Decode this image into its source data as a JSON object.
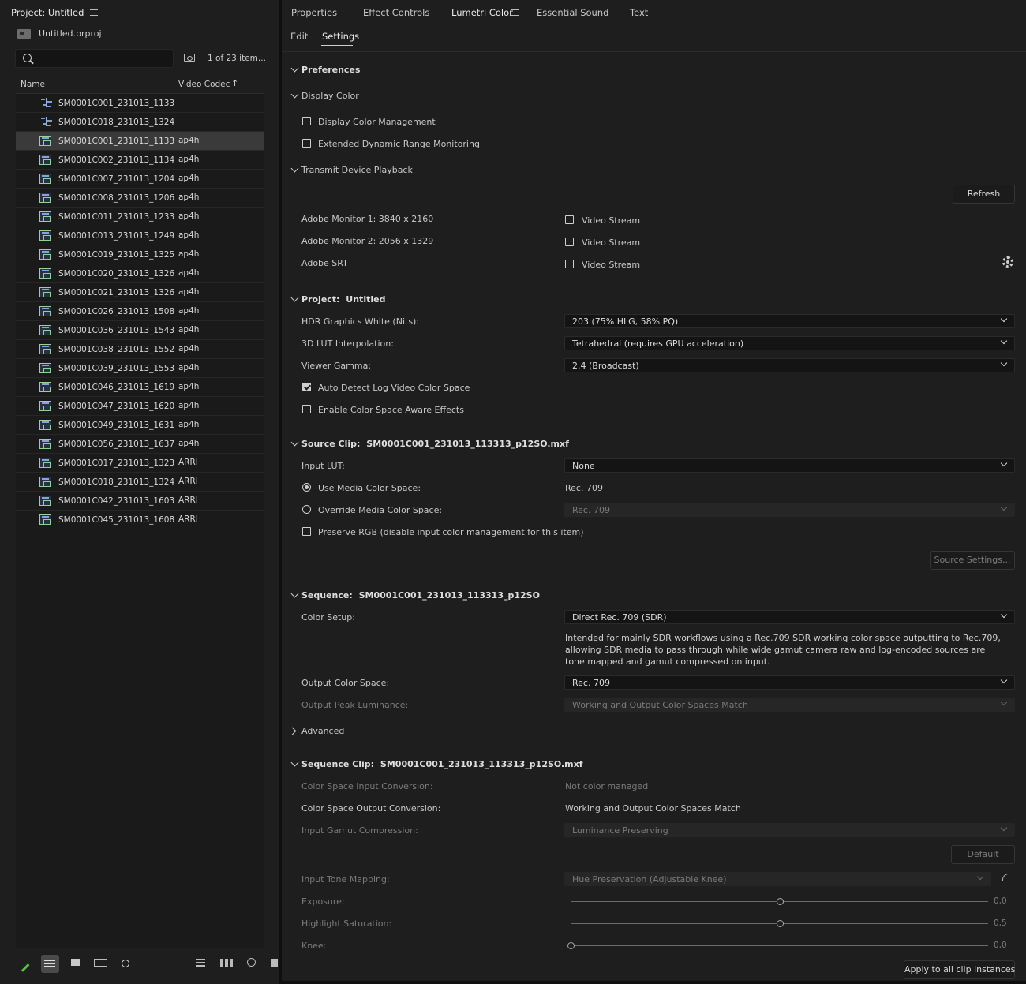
{
  "project_panel": {
    "title": "Project: Untitled",
    "file": "Untitled.prproj",
    "search_value": "",
    "item_count": "1 of 23 item...",
    "columns": {
      "name": "Name",
      "codec": "Video Codec"
    },
    "items": [
      {
        "name": "SM0001C001_231013_1133",
        "codec": "",
        "type": "sequence"
      },
      {
        "name": "SM0001C018_231013_1324",
        "codec": "",
        "type": "sequence"
      },
      {
        "name": "SM0001C001_231013_1133",
        "codec": "ap4h",
        "type": "clip",
        "selected": true
      },
      {
        "name": "SM0001C002_231013_1134",
        "codec": "ap4h",
        "type": "clip"
      },
      {
        "name": "SM0001C007_231013_1204",
        "codec": "ap4h",
        "type": "clip"
      },
      {
        "name": "SM0001C008_231013_1206",
        "codec": "ap4h",
        "type": "clip"
      },
      {
        "name": "SM0001C011_231013_1233",
        "codec": "ap4h",
        "type": "clip"
      },
      {
        "name": "SM0001C013_231013_1249",
        "codec": "ap4h",
        "type": "clip"
      },
      {
        "name": "SM0001C019_231013_1325",
        "codec": "ap4h",
        "type": "clip"
      },
      {
        "name": "SM0001C020_231013_1326",
        "codec": "ap4h",
        "type": "clip"
      },
      {
        "name": "SM0001C021_231013_1326",
        "codec": "ap4h",
        "type": "clip"
      },
      {
        "name": "SM0001C026_231013_1508",
        "codec": "ap4h",
        "type": "clip"
      },
      {
        "name": "SM0001C036_231013_1543",
        "codec": "ap4h",
        "type": "clip"
      },
      {
        "name": "SM0001C038_231013_1552",
        "codec": "ap4h",
        "type": "clip"
      },
      {
        "name": "SM0001C039_231013_1553",
        "codec": "ap4h",
        "type": "clip"
      },
      {
        "name": "SM0001C046_231013_1619",
        "codec": "ap4h",
        "type": "clip"
      },
      {
        "name": "SM0001C047_231013_1620",
        "codec": "ap4h",
        "type": "clip"
      },
      {
        "name": "SM0001C049_231013_1631",
        "codec": "ap4h",
        "type": "clip"
      },
      {
        "name": "SM0001C056_231013_1637",
        "codec": "ap4h",
        "type": "clip"
      },
      {
        "name": "SM0001C017_231013_1323",
        "codec": "ARRI",
        "type": "clip"
      },
      {
        "name": "SM0001C018_231013_1324",
        "codec": "ARRI",
        "type": "clip"
      },
      {
        "name": "SM0001C042_231013_1603",
        "codec": "ARRI",
        "type": "clip"
      },
      {
        "name": "SM0001C045_231013_1608",
        "codec": "ARRI",
        "type": "clip"
      }
    ]
  },
  "tabs": [
    "Properties",
    "Effect Controls",
    "Lumetri Color",
    "Essential Sound",
    "Text"
  ],
  "active_tab": "Lumetri Color",
  "subtabs": [
    "Edit",
    "Settings"
  ],
  "active_subtab": "Settings",
  "preferences": {
    "label": "Preferences"
  },
  "display_color": {
    "label": "Display Color",
    "display_color_management": {
      "label": "Display Color Management",
      "checked": false
    },
    "edr_monitoring": {
      "label": "Extended Dynamic Range Monitoring",
      "checked": false
    }
  },
  "transmit": {
    "label": "Transmit Device Playback",
    "refresh": "Refresh",
    "devices": [
      {
        "name": "Adobe Monitor 1: 3840 x 2160",
        "stream": "Video Stream",
        "checked": false
      },
      {
        "name": "Adobe Monitor 2: 2056 x 1329",
        "stream": "Video Stream",
        "checked": false
      },
      {
        "name": "Adobe SRT",
        "stream": "Video Stream",
        "checked": false
      }
    ]
  },
  "project": {
    "label": "Project:",
    "value": "Untitled",
    "hdr_white": {
      "label": "HDR Graphics White (Nits):",
      "value": "203 (75% HLG, 58% PQ)"
    },
    "lut_interp": {
      "label": "3D LUT Interpolation:",
      "value": "Tetrahedral (requires GPU acceleration)"
    },
    "viewer_gamma": {
      "label": "Viewer Gamma:",
      "value": "2.4 (Broadcast)"
    },
    "auto_detect_log": {
      "label": "Auto Detect Log Video Color Space",
      "checked": true
    },
    "color_space_aware": {
      "label": "Enable Color Space Aware Effects",
      "checked": false
    }
  },
  "source_clip": {
    "label": "Source Clip:",
    "value": "SM0001C001_231013_113313_p12SO.mxf",
    "input_lut": {
      "label": "Input LUT:",
      "value": "None"
    },
    "use_media": {
      "label": "Use Media Color Space:",
      "value": "Rec. 709",
      "selected": true
    },
    "override_media": {
      "label": "Override Media Color Space:",
      "value": "Rec. 709",
      "selected": false
    },
    "preserve_rgb": {
      "label": "Preserve RGB (disable input color management for this item)",
      "checked": false
    },
    "source_settings": "Source Settings..."
  },
  "sequence": {
    "label": "Sequence:",
    "value": "SM0001C001_231013_113313_p12SO",
    "color_setup": {
      "label": "Color Setup:",
      "value": "Direct Rec. 709 (SDR)"
    },
    "description": "Intended for mainly SDR workflows using a Rec.709 SDR working color space outputting to Rec.709, allowing SDR media to pass through while wide gamut camera raw and log-encoded sources are tone mapped and gamut compressed on input.",
    "output_cs": {
      "label": "Output Color Space:",
      "value": "Rec. 709"
    },
    "peak_luminance": {
      "label": "Output Peak Luminance:",
      "value": "Working and Output Color Spaces Match"
    },
    "advanced": "Advanced"
  },
  "sequence_clip": {
    "label": "Sequence Clip:",
    "value": "SM0001C001_231013_113313_p12SO.mxf",
    "input_conversion": {
      "label": "Color Space Input Conversion:",
      "value": "Not color managed"
    },
    "output_conversion": {
      "label": "Color Space Output Conversion:",
      "value": "Working and Output Color Spaces Match"
    },
    "gamut_compression": {
      "label": "Input Gamut Compression:",
      "value": "Luminance Preserving"
    },
    "default_btn": "Default",
    "tone_mapping": {
      "label": "Input Tone Mapping:",
      "value": "Hue Preservation (Adjustable Knee)"
    },
    "exposure": {
      "label": "Exposure:",
      "value": "0,0",
      "level": 0.5
    },
    "highlight_sat": {
      "label": "Highlight Saturation:",
      "value": "0,5",
      "level": 0.5
    },
    "knee": {
      "label": "Knee:",
      "value": "0,0",
      "level": 0.0
    },
    "apply_all": "Apply to all clip instances"
  }
}
